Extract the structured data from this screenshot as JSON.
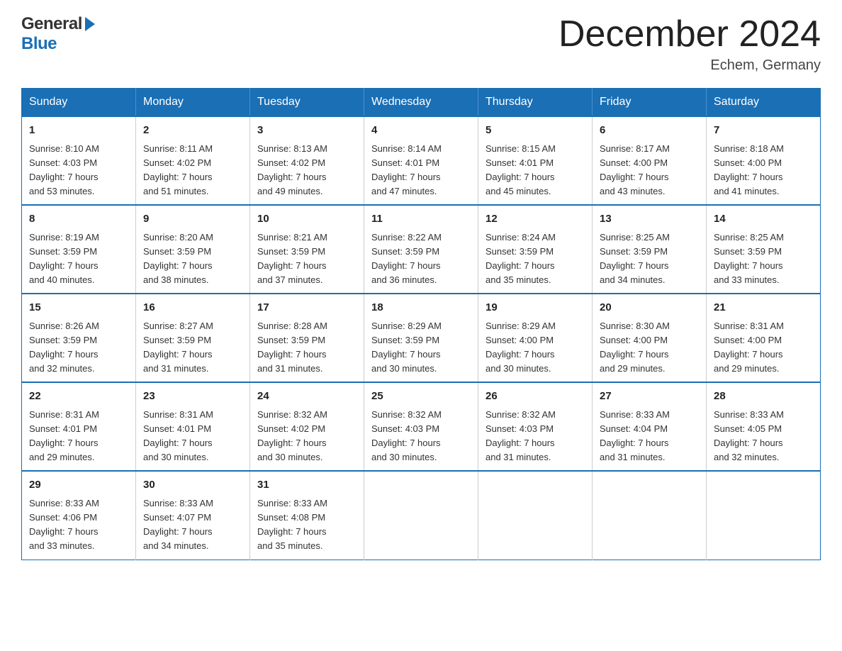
{
  "header": {
    "logo_general": "General",
    "logo_blue": "Blue",
    "month_title": "December 2024",
    "location": "Echem, Germany"
  },
  "days_of_week": [
    "Sunday",
    "Monday",
    "Tuesday",
    "Wednesday",
    "Thursday",
    "Friday",
    "Saturday"
  ],
  "weeks": [
    [
      {
        "num": "1",
        "sunrise": "8:10 AM",
        "sunset": "4:03 PM",
        "daylight": "7 hours and 53 minutes."
      },
      {
        "num": "2",
        "sunrise": "8:11 AM",
        "sunset": "4:02 PM",
        "daylight": "7 hours and 51 minutes."
      },
      {
        "num": "3",
        "sunrise": "8:13 AM",
        "sunset": "4:02 PM",
        "daylight": "7 hours and 49 minutes."
      },
      {
        "num": "4",
        "sunrise": "8:14 AM",
        "sunset": "4:01 PM",
        "daylight": "7 hours and 47 minutes."
      },
      {
        "num": "5",
        "sunrise": "8:15 AM",
        "sunset": "4:01 PM",
        "daylight": "7 hours and 45 minutes."
      },
      {
        "num": "6",
        "sunrise": "8:17 AM",
        "sunset": "4:00 PM",
        "daylight": "7 hours and 43 minutes."
      },
      {
        "num": "7",
        "sunrise": "8:18 AM",
        "sunset": "4:00 PM",
        "daylight": "7 hours and 41 minutes."
      }
    ],
    [
      {
        "num": "8",
        "sunrise": "8:19 AM",
        "sunset": "3:59 PM",
        "daylight": "7 hours and 40 minutes."
      },
      {
        "num": "9",
        "sunrise": "8:20 AM",
        "sunset": "3:59 PM",
        "daylight": "7 hours and 38 minutes."
      },
      {
        "num": "10",
        "sunrise": "8:21 AM",
        "sunset": "3:59 PM",
        "daylight": "7 hours and 37 minutes."
      },
      {
        "num": "11",
        "sunrise": "8:22 AM",
        "sunset": "3:59 PM",
        "daylight": "7 hours and 36 minutes."
      },
      {
        "num": "12",
        "sunrise": "8:24 AM",
        "sunset": "3:59 PM",
        "daylight": "7 hours and 35 minutes."
      },
      {
        "num": "13",
        "sunrise": "8:25 AM",
        "sunset": "3:59 PM",
        "daylight": "7 hours and 34 minutes."
      },
      {
        "num": "14",
        "sunrise": "8:25 AM",
        "sunset": "3:59 PM",
        "daylight": "7 hours and 33 minutes."
      }
    ],
    [
      {
        "num": "15",
        "sunrise": "8:26 AM",
        "sunset": "3:59 PM",
        "daylight": "7 hours and 32 minutes."
      },
      {
        "num": "16",
        "sunrise": "8:27 AM",
        "sunset": "3:59 PM",
        "daylight": "7 hours and 31 minutes."
      },
      {
        "num": "17",
        "sunrise": "8:28 AM",
        "sunset": "3:59 PM",
        "daylight": "7 hours and 31 minutes."
      },
      {
        "num": "18",
        "sunrise": "8:29 AM",
        "sunset": "3:59 PM",
        "daylight": "7 hours and 30 minutes."
      },
      {
        "num": "19",
        "sunrise": "8:29 AM",
        "sunset": "4:00 PM",
        "daylight": "7 hours and 30 minutes."
      },
      {
        "num": "20",
        "sunrise": "8:30 AM",
        "sunset": "4:00 PM",
        "daylight": "7 hours and 29 minutes."
      },
      {
        "num": "21",
        "sunrise": "8:31 AM",
        "sunset": "4:00 PM",
        "daylight": "7 hours and 29 minutes."
      }
    ],
    [
      {
        "num": "22",
        "sunrise": "8:31 AM",
        "sunset": "4:01 PM",
        "daylight": "7 hours and 29 minutes."
      },
      {
        "num": "23",
        "sunrise": "8:31 AM",
        "sunset": "4:01 PM",
        "daylight": "7 hours and 30 minutes."
      },
      {
        "num": "24",
        "sunrise": "8:32 AM",
        "sunset": "4:02 PM",
        "daylight": "7 hours and 30 minutes."
      },
      {
        "num": "25",
        "sunrise": "8:32 AM",
        "sunset": "4:03 PM",
        "daylight": "7 hours and 30 minutes."
      },
      {
        "num": "26",
        "sunrise": "8:32 AM",
        "sunset": "4:03 PM",
        "daylight": "7 hours and 31 minutes."
      },
      {
        "num": "27",
        "sunrise": "8:33 AM",
        "sunset": "4:04 PM",
        "daylight": "7 hours and 31 minutes."
      },
      {
        "num": "28",
        "sunrise": "8:33 AM",
        "sunset": "4:05 PM",
        "daylight": "7 hours and 32 minutes."
      }
    ],
    [
      {
        "num": "29",
        "sunrise": "8:33 AM",
        "sunset": "4:06 PM",
        "daylight": "7 hours and 33 minutes."
      },
      {
        "num": "30",
        "sunrise": "8:33 AM",
        "sunset": "4:07 PM",
        "daylight": "7 hours and 34 minutes."
      },
      {
        "num": "31",
        "sunrise": "8:33 AM",
        "sunset": "4:08 PM",
        "daylight": "7 hours and 35 minutes."
      },
      null,
      null,
      null,
      null
    ]
  ],
  "labels": {
    "sunrise": "Sunrise:",
    "sunset": "Sunset:",
    "daylight": "Daylight:"
  }
}
